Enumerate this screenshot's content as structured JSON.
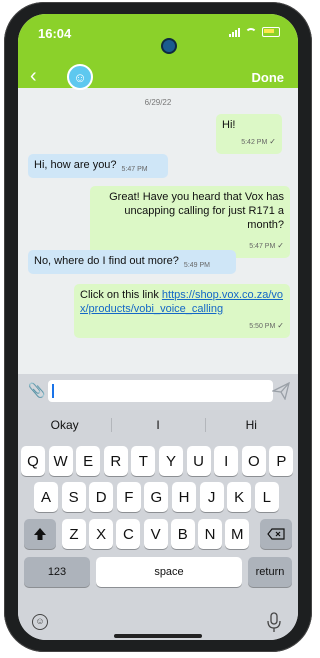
{
  "status": {
    "time": "16:04"
  },
  "header": {
    "done_label": "Done",
    "back_icon": "chevron-left-icon",
    "avatar_icon": "smiley-icon"
  },
  "chat": {
    "date": "6/29/22",
    "messages": [
      {
        "dir": "out",
        "text": "Hi!",
        "time": "5:42 PM",
        "status": "✓"
      },
      {
        "dir": "in",
        "text": "Hi, how are you?",
        "time": "5:47 PM"
      },
      {
        "dir": "out",
        "text": "Great! Have you heard that Vox has uncapping calling for just R171 a month?",
        "time": "5:47 PM",
        "status": "✓"
      },
      {
        "dir": "in",
        "text": "No, where do I find out more?",
        "time": "5:49 PM"
      },
      {
        "dir": "out",
        "text": "Click on this link ",
        "link": "https://shop.vox.co.za/vox/products/vobi_voice_calling",
        "time": "5:50 PM",
        "status": "✓"
      }
    ]
  },
  "input": {
    "value": ""
  },
  "keyboard": {
    "suggestions": [
      "Okay",
      "I",
      "Hi"
    ],
    "row1": [
      "Q",
      "W",
      "E",
      "R",
      "T",
      "Y",
      "U",
      "I",
      "O",
      "P"
    ],
    "row2": [
      "A",
      "S",
      "D",
      "F",
      "G",
      "H",
      "J",
      "K",
      "L"
    ],
    "row3": [
      "Z",
      "X",
      "C",
      "V",
      "B",
      "N",
      "M"
    ],
    "numbers": "123",
    "space": "space",
    "return": "return"
  },
  "colors": {
    "accent": "#8bd12a",
    "outgoing": "#dcf8c6",
    "incoming": "#cfe6f7"
  }
}
